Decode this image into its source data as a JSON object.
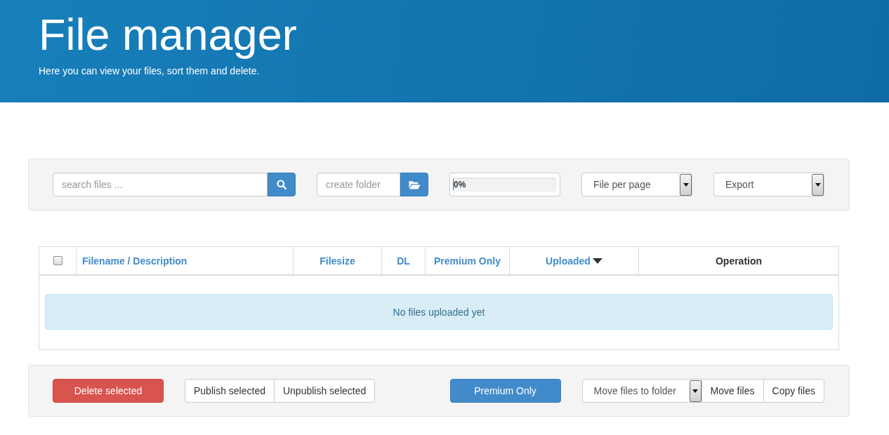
{
  "header": {
    "title": "File manager",
    "subtitle": "Here you can view your files, sort them and delete."
  },
  "toolbar": {
    "search": {
      "placeholder": "search files ..."
    },
    "new_folder": {
      "placeholder": "create folder"
    },
    "progress": {
      "level": 0,
      "reading": "0%"
    },
    "selects": [
      {
        "value": "File per page"
      },
      {
        "value": "Export"
      }
    ]
  },
  "table": {
    "select_all": {
      "checked": false
    },
    "columns": [
      {
        "label": "Filename / Description",
        "sortable": true,
        "sorted": false
      },
      {
        "label": "Filesize",
        "sortable": true,
        "sorted": false
      },
      {
        "label": "DL",
        "sortable": true,
        "sorted": false
      },
      {
        "label": "Premium Only",
        "sortable": true,
        "sorted": false
      },
      {
        "label": "Uploaded",
        "sortable": true,
        "sorted": true
      },
      {
        "label": "Operation",
        "sortable": false,
        "sorted": false
      }
    ],
    "empty_message": "No files uploaded yet"
  },
  "actions": {
    "groups": [
      {
        "buttons": [
          {
            "label": "Delete selected",
            "kind": "danger"
          }
        ]
      },
      {
        "buttons": [
          {
            "label": "Publish selected",
            "kind": "default"
          },
          {
            "label": "Unpublish selected",
            "kind": "default"
          }
        ]
      },
      {
        "buttons": [
          {
            "label": "Premium Only",
            "kind": "primary"
          }
        ]
      },
      {
        "buttons": [
          {
            "label": "Move files to folder",
            "kind": "select"
          },
          {
            "label": "Move files",
            "kind": "default"
          },
          {
            "label": "Copy files",
            "kind": "default"
          }
        ]
      }
    ]
  }
}
